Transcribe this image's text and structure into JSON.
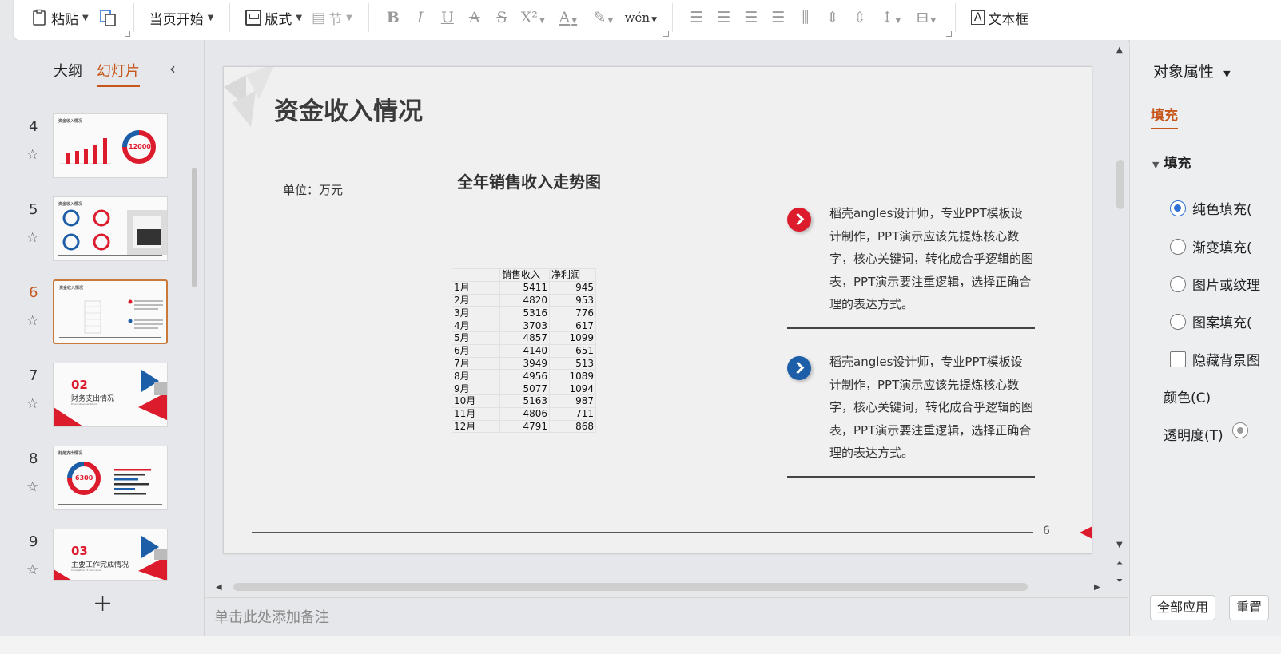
{
  "ribbon": {
    "paste_label": "粘贴",
    "start_from_current_label": "当页开始",
    "layout_label": "版式",
    "section_label": "节",
    "superscript_label": "X²",
    "phonetic_label": "wén",
    "textbox_label": "文本框"
  },
  "left_pane": {
    "tab_outline": "大纲",
    "tab_slides": "幻灯片",
    "collapse_glyph": "‹",
    "add_glyph": "+",
    "slides": [
      {
        "num": "4",
        "title": "资金收入情况",
        "big": "12000"
      },
      {
        "num": "5",
        "title": "资金收入情况"
      },
      {
        "num": "6",
        "title": "资金收入情况",
        "current": true
      },
      {
        "num": "7",
        "big": "02",
        "caption": "财务支出情况",
        "sub": "Financial expenditure"
      },
      {
        "num": "8",
        "title": "财务支出情况",
        "big": "6300"
      },
      {
        "num": "9",
        "big": "03",
        "caption": "主要工作完成情况",
        "sub": "Completion of main work"
      }
    ]
  },
  "slide": {
    "title": "资金收入情况",
    "unit": "单位：万元",
    "chart_title": "全年销售收入走势图",
    "table": {
      "headers": [
        "",
        "销售收入",
        "净利润"
      ],
      "rows": [
        [
          "1月",
          "5411",
          "945"
        ],
        [
          "2月",
          "4820",
          "953"
        ],
        [
          "3月",
          "5316",
          "776"
        ],
        [
          "4月",
          "3703",
          "617"
        ],
        [
          "5月",
          "4857",
          "1099"
        ],
        [
          "6月",
          "4140",
          "651"
        ],
        [
          "7月",
          "3949",
          "513"
        ],
        [
          "8月",
          "4956",
          "1089"
        ],
        [
          "9月",
          "5077",
          "1094"
        ],
        [
          "10月",
          "5163",
          "987"
        ],
        [
          "11月",
          "4806",
          "711"
        ],
        [
          "12月",
          "4791",
          "868"
        ]
      ]
    },
    "text_block_1": "稻壳angles设计师，专业PPT模板设计制作，PPT演示应该先提炼核心数字，核心关键词，转化成合乎逻辑的图表，PPT演示要注重逻辑，选择正确合理的表达方式。",
    "text_block_2": "稻壳angles设计师，专业PPT模板设计制作，PPT演示应该先提炼核心数字，核心关键词，转化成合乎逻辑的图表，PPT演示要注重逻辑，选择正确合理的表达方式。",
    "page_number": "6"
  },
  "notes": {
    "placeholder": "单击此处添加备注"
  },
  "right_pane": {
    "title": "对象属性",
    "tab": "填充",
    "section": "填充",
    "options": [
      "纯色填充(",
      "渐变填充(",
      "图片或纹理",
      "图案填充(",
      "隐藏背景图"
    ],
    "color_label": "颜色(C)",
    "transparency_label": "透明度(T)",
    "apply_all_button": "全部应用",
    "reset_button": "重置"
  },
  "colors": {
    "accent_orange": "#c7561a",
    "brand_red": "#dc1c2d",
    "brand_blue": "#1d5ea8"
  }
}
